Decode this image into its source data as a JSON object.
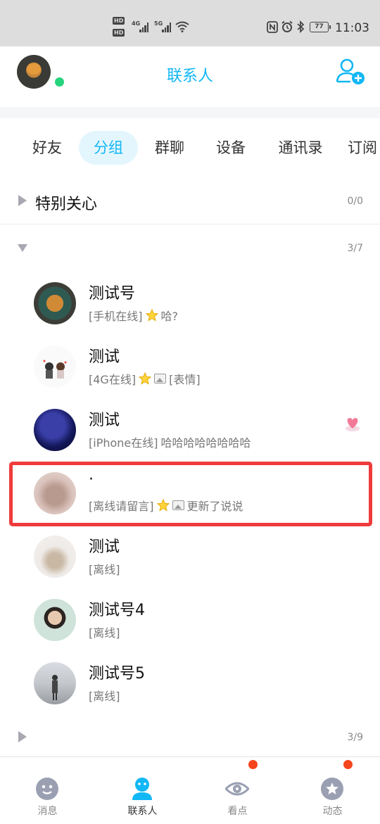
{
  "status_bar": {
    "time": "11:03",
    "battery": "77",
    "network_4g": "4G",
    "network_5g": "5G",
    "hd1": "HD",
    "hd2": "HD",
    "icons": [
      "nfc-icon",
      "alarm-icon",
      "bluetooth-icon",
      "battery-icon",
      "wifi-icon",
      "signal-icon"
    ]
  },
  "header": {
    "title": "联系人",
    "add_friend_icon": "add-friend-icon",
    "avatar_status": "online"
  },
  "tabs": [
    {
      "label": "好友",
      "active": false
    },
    {
      "label": "分组",
      "active": true
    },
    {
      "label": "群聊",
      "active": false
    },
    {
      "label": "设备",
      "active": false
    },
    {
      "label": "通讯录",
      "active": false
    },
    {
      "label": "订阅",
      "active": false
    }
  ],
  "groups": [
    {
      "name": "特别关心",
      "count": "0/0",
      "expanded": false
    },
    {
      "name": "",
      "count": "3/7",
      "expanded": true
    },
    {
      "name": "",
      "count": "3/9",
      "expanded": false
    }
  ],
  "contacts": [
    {
      "name": "测试号",
      "status": "[手机在线]",
      "star": true,
      "picture": false,
      "message": "哈?"
    },
    {
      "name": "测试",
      "status": "[4G在线]",
      "star": true,
      "picture": true,
      "message": "[表情]"
    },
    {
      "name": "测试",
      "status": "[iPhone在线]",
      "star": false,
      "picture": false,
      "message": "哈哈哈哈哈哈哈哈",
      "badge": "heart-icon"
    },
    {
      "name": "·",
      "status": "[离线请留言]",
      "star": true,
      "picture": true,
      "message": "更新了说说",
      "highlighted": true
    },
    {
      "name": "测试",
      "status": "[离线]",
      "star": false,
      "picture": false,
      "message": ""
    },
    {
      "name": "测试号4",
      "status": "[离线]",
      "star": false,
      "picture": false,
      "message": ""
    },
    {
      "name": "测试号5",
      "status": "[离线]",
      "star": false,
      "picture": false,
      "message": ""
    }
  ],
  "bottom_nav": [
    {
      "label": "消息",
      "active": false,
      "dot": false
    },
    {
      "label": "联系人",
      "active": true,
      "dot": false
    },
    {
      "label": "看点",
      "active": false,
      "dot": true
    },
    {
      "label": "动态",
      "active": false,
      "dot": true
    }
  ],
  "colors": {
    "accent": "#12b7f5",
    "online": "#27d47e",
    "highlight": "#ef3b3b",
    "notification": "#f5451d"
  }
}
